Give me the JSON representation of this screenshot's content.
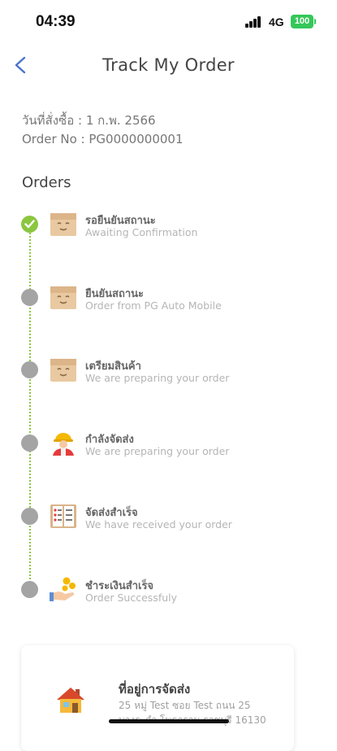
{
  "status_bar": {
    "time": "04:39",
    "network": "4G",
    "battery": "100"
  },
  "header": {
    "title": "Track My Order"
  },
  "order": {
    "date_line": "วันที่สั่งซื้อ : 1 ก.พ. 2566",
    "number_line": "Order No : PG0000000001"
  },
  "orders_heading": "Orders",
  "steps": [
    {
      "title": "รอยืนยันสถานะ",
      "subtitle": "Awaiting Confirmation",
      "icon": "box-icon",
      "done": true
    },
    {
      "title": "ยืนยันสถานะ",
      "subtitle": "Order from PG Auto Mobile",
      "icon": "box-icon",
      "done": false
    },
    {
      "title": "เตรียมสินค้า",
      "subtitle": "We are preparing your order",
      "icon": "box-icon",
      "done": false
    },
    {
      "title": "กำลังจัดส่ง",
      "subtitle": "We are preparing your order",
      "icon": "delivery-worker-icon",
      "done": false
    },
    {
      "title": "จัดส่งสำเร็จ",
      "subtitle": "We have received your order",
      "icon": "checklist-icon",
      "done": false
    },
    {
      "title": "ชำระเงินสำเร็จ",
      "subtitle": "Order Successfuly",
      "icon": "coins-hand-icon",
      "done": false
    }
  ],
  "address": {
    "title": "ที่อยู่การจัดส่ง",
    "line1": "25 หมู่ Test ซอย Test ถนน 25",
    "line2": "บางระกำ โพธาราม ราชบุรี 16130"
  },
  "colors": {
    "done": "#8cc63f",
    "pending": "#a4a4a4",
    "accent": "#4a74c9"
  }
}
